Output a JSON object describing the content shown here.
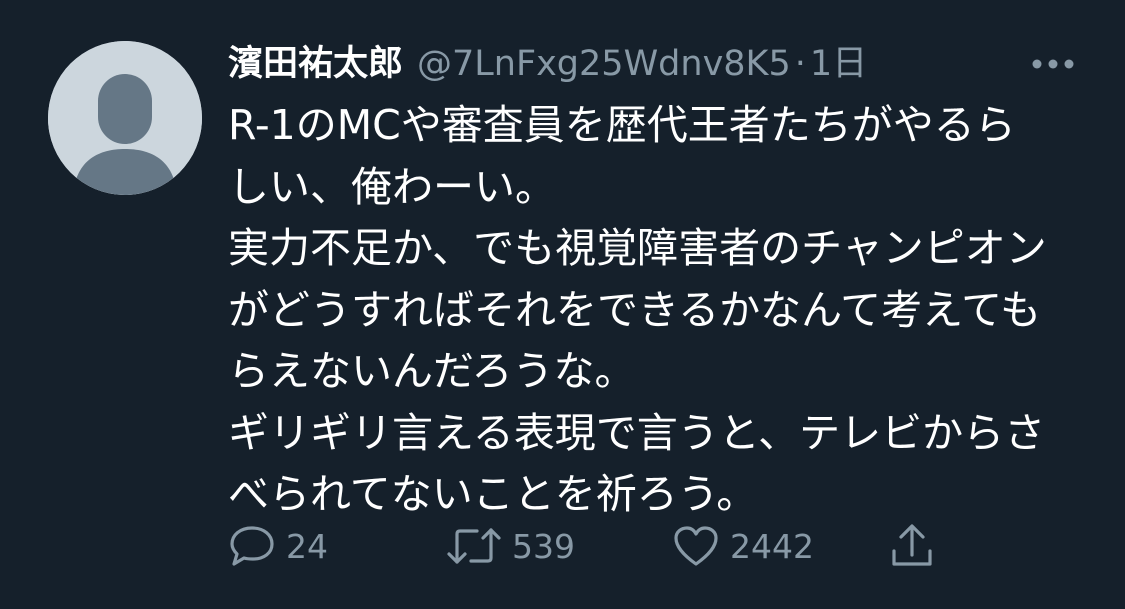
{
  "tweet": {
    "display_name": "濱田祐太郎",
    "handle": "@7LnFxg25Wdnv8K5",
    "separator": "·",
    "time": "1日",
    "more_icon": "more-horizontal-icon",
    "avatar_icon": "default-avatar-icon",
    "lines": [
      "R-1のMCや審査員を歴代王者たちがやるら",
      "しい、俺わーい。",
      "実力不足か、でも視覚障害者のチャンピオン",
      "がどうすればそれをできるかなんて考えても",
      "らえないんだろうな。",
      "ギリギリ言える表現で言うと、テレビからさ",
      "べられてないことを祈ろう。"
    ]
  },
  "actions": {
    "reply": {
      "icon": "comment-icon",
      "count": "24"
    },
    "retweet": {
      "icon": "retweet-icon",
      "count": "539"
    },
    "like": {
      "icon": "heart-icon",
      "count": "2442"
    },
    "share": {
      "icon": "share-icon"
    }
  },
  "colors": {
    "background": "#15202b",
    "text": "#ffffff",
    "secondary": "#8899a6",
    "avatar_bg": "#ccd6dd",
    "avatar_figure": "#657786"
  }
}
